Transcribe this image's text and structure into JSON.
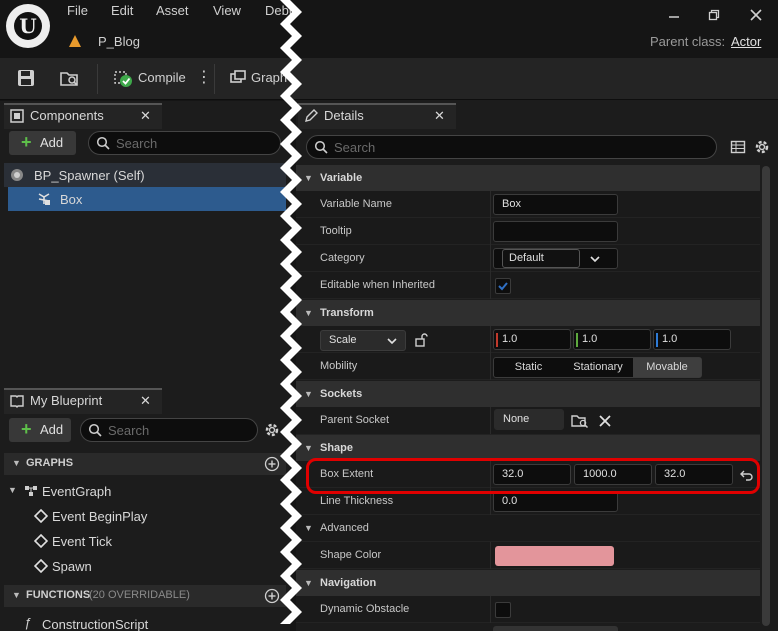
{
  "menu": {
    "items": [
      "File",
      "Edit",
      "Asset",
      "View",
      "Debu"
    ]
  },
  "tab": {
    "label": "P_Blog"
  },
  "window": {
    "parent_class_label": "Parent class:",
    "parent_class_value": "Actor"
  },
  "toolbar": {
    "compile_label": "Compile",
    "graph_label": "Graph"
  },
  "components_panel": {
    "title": "Components",
    "add_label": "Add",
    "search_placeholder": "Search",
    "tree": [
      {
        "label": "BP_Spawner (Self)",
        "icon": "actor-icon"
      },
      {
        "label": "Box",
        "icon": "box-collision-icon",
        "selected": true
      }
    ]
  },
  "my_blueprint_panel": {
    "title": "My Blueprint",
    "add_label": "Add",
    "search_placeholder": "Search",
    "graphs_header": "GRAPHS",
    "event_graph": "EventGraph",
    "events": [
      "Event BeginPlay",
      "Event Tick",
      "Spawn"
    ],
    "functions_header": "FUNCTIONS",
    "functions_count": "(20 OVERRIDABLE)",
    "construction_script": "ConstructionScript"
  },
  "details_panel": {
    "title": "Details",
    "search_placeholder": "Search",
    "variable": {
      "header": "Variable",
      "name_label": "Variable Name",
      "name_value": "Box",
      "tooltip_label": "Tooltip",
      "tooltip_value": "",
      "category_label": "Category",
      "category_value": "Default",
      "editable_label": "Editable when Inherited",
      "editable_checked": true
    },
    "transform": {
      "header": "Transform",
      "scale_label": "Scale",
      "scale_values": [
        "1.0",
        "1.0",
        "1.0"
      ],
      "mobility_label": "Mobility",
      "mobility_options": [
        "Static",
        "Stationary",
        "Movable"
      ],
      "mobility_selected": "Movable"
    },
    "sockets": {
      "header": "Sockets",
      "parent_socket_label": "Parent Socket",
      "parent_socket_value": "None"
    },
    "shape": {
      "header": "Shape",
      "box_extent_label": "Box Extent",
      "box_extent_values": [
        "32.0",
        "1000.0",
        "32.0"
      ],
      "line_thickness_label": "Line Thickness",
      "line_thickness_value": "0.0",
      "advanced_label": "Advanced",
      "shape_color_label": "Shape Color",
      "shape_color": "#e3959b"
    },
    "navigation": {
      "header": "Navigation",
      "dynamic_obstacle_label": "Dynamic Obstacle",
      "dynamic_obstacle_checked": false
    }
  },
  "colors": {
    "accent_blue": "#2f6fc4",
    "highlight_red": "#e00000",
    "axis_x": "#c0392b",
    "axis_y": "#5ea93e",
    "axis_z": "#2e7bd6",
    "add_green": "#5ec04a"
  }
}
